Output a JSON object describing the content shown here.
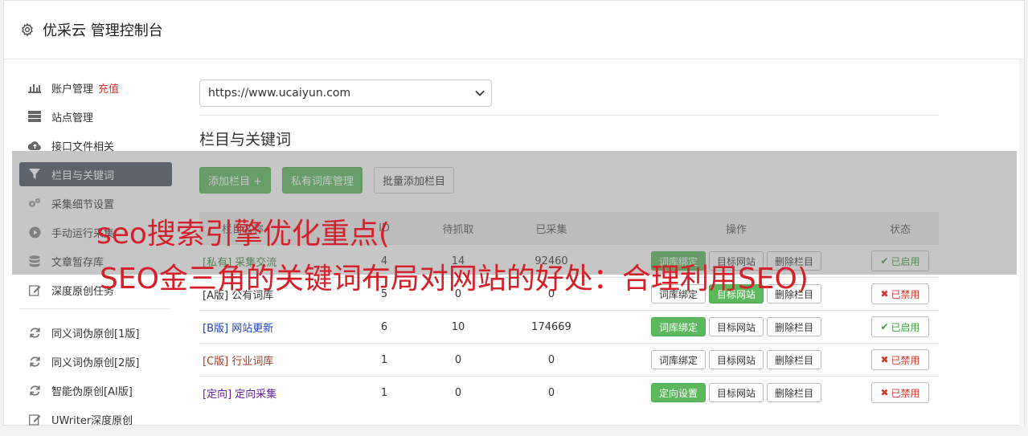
{
  "header": {
    "title": "优采云 管理控制台"
  },
  "sidebar": {
    "items": [
      {
        "label": "账户管理",
        "extra": "充值",
        "icon": "bar-chart-icon"
      },
      {
        "label": "站点管理",
        "icon": "server-icon"
      },
      {
        "label": "接口文件相关",
        "icon": "cloud-upload-icon"
      },
      {
        "label": "栏目与关键词",
        "icon": "filter-icon",
        "active": true
      },
      {
        "label": "采集细节设置",
        "icon": "cogs-icon"
      },
      {
        "label": "手动运行采集",
        "icon": "play-circle-icon"
      },
      {
        "label": "文章暂存库",
        "icon": "database-icon"
      },
      {
        "label": "深度原创任务",
        "icon": "edit-icon"
      }
    ],
    "items2": [
      {
        "label": "同义词伪原创[1版]",
        "icon": "refresh-icon"
      },
      {
        "label": "同义词伪原创[2版]",
        "icon": "refresh-icon"
      },
      {
        "label": "智能伪原创[AI版]",
        "icon": "refresh-icon"
      },
      {
        "label": "UWriter深度原创",
        "icon": "edit-icon"
      }
    ]
  },
  "main": {
    "site_select": {
      "value": "https://www.ucaiyun.com"
    },
    "section_title": "栏目与关键词",
    "buttons": {
      "add_column": "添加栏目 +",
      "private_lib": "私有词库管理",
      "batch_add": "批量添加栏目"
    },
    "table": {
      "headers": {
        "name": "栏目名称",
        "id": "ID",
        "pending": "待抓取",
        "collected": "已采集",
        "ops": "操作",
        "status": "状态"
      },
      "rows": [
        {
          "tag": "[私有]",
          "name": "采集交流",
          "id": "4",
          "pending": "14",
          "collected": "92460",
          "op1": "词库绑定",
          "op2": "目标网站",
          "op3": "删除栏目",
          "status": "已启用"
        },
        {
          "tag": "[A版]",
          "name": "公有词库",
          "id": "5",
          "pending": "0",
          "collected": "0",
          "op1": "词库绑定",
          "op2": "目标网站",
          "op3": "删除栏目",
          "status": "已禁用"
        },
        {
          "tag": "[B版]",
          "name": "网站更新",
          "id": "6",
          "pending": "10",
          "collected": "174669",
          "op1": "词库绑定",
          "op2": "目标网站",
          "op3": "删除栏目",
          "status": "已启用"
        },
        {
          "tag": "[C版]",
          "name": "行业词库",
          "id": "1",
          "pending": "0",
          "collected": "0",
          "op1": "词库绑定",
          "op2": "目标网站",
          "op3": "删除栏目",
          "status": "已禁用"
        },
        {
          "tag": "[定向]",
          "name": "定向采集",
          "id": "1",
          "pending": "0",
          "collected": "0",
          "op1": "定向设置",
          "op2": "目标网站",
          "op3": "删除栏目",
          "status": "已禁用"
        }
      ]
    }
  },
  "overlay": {
    "line1": "seo搜索引擎优化重点(",
    "line2": "SEO金三角的关键词布局对网站的好处：合理利用SEO)"
  },
  "colors": {
    "active_nav": "#4c5462",
    "green": "#5cb85c",
    "red": "#d9342b",
    "overlay_text": "#d5202a"
  }
}
